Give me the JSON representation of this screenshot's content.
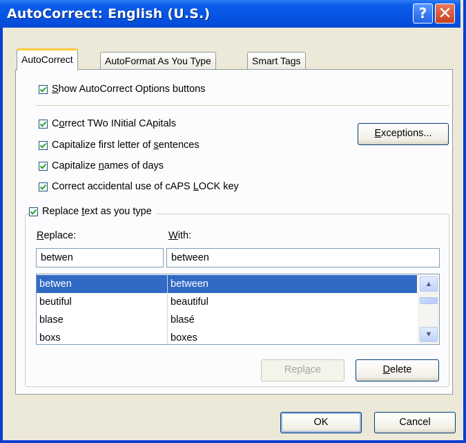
{
  "window": {
    "title": "AutoCorrect: English (U.S.)",
    "help_glyph": "?",
    "close_glyph": "✕",
    "colors": {
      "titlebar": "#0653e3",
      "selection": "#316ac5",
      "active_tab_accent": "#ffc83c"
    }
  },
  "tabs": [
    {
      "label": "AutoCorrect",
      "active": true
    },
    {
      "label": "AutoFormat As You Type",
      "active": false
    },
    {
      "label": "Smart Tags",
      "active": false
    }
  ],
  "options": {
    "show_buttons": {
      "pre": "",
      "key": "S",
      "post": "how AutoCorrect Options buttons",
      "checked": true
    },
    "two_initial": {
      "pre": "C",
      "key": "o",
      "post": "rrect TWo INitial CApitals",
      "checked": true
    },
    "first_letter": {
      "pre": "Capitalize first letter of ",
      "key": "s",
      "post": "entences",
      "checked": true
    },
    "days": {
      "pre": "Capitalize ",
      "key": "n",
      "post": "ames of days",
      "checked": true
    },
    "caps_lock": {
      "pre": "Correct accidental use of cAPS ",
      "key": "L",
      "post": "OCK key",
      "checked": true
    },
    "replace_text": {
      "pre": "Replace ",
      "key": "t",
      "post": "ext as you type",
      "checked": true
    }
  },
  "buttons": {
    "exceptions": {
      "pre": "",
      "key": "E",
      "post": "xceptions..."
    },
    "replace": {
      "pre": "Repl",
      "key": "a",
      "post": "ce",
      "disabled": true
    },
    "delete": {
      "pre": "",
      "key": "D",
      "post": "elete"
    },
    "ok": "OK",
    "cancel": "Cancel"
  },
  "replace_section": {
    "replace_label": {
      "pre": "",
      "key": "R",
      "post": "eplace:"
    },
    "with_label": {
      "pre": "",
      "key": "W",
      "post": "ith:"
    },
    "replace_value": "betwen",
    "with_value": "between"
  },
  "entries": [
    {
      "replace": "betwen",
      "with": "between",
      "selected": true
    },
    {
      "replace": "beutiful",
      "with": "beautiful",
      "selected": false
    },
    {
      "replace": "blase",
      "with": "blasé",
      "selected": false
    },
    {
      "replace": "boxs",
      "with": "boxes",
      "selected": false
    }
  ],
  "scrollbar": {
    "up_icon": "▲",
    "down_icon": "▼",
    "position": 0.04
  }
}
